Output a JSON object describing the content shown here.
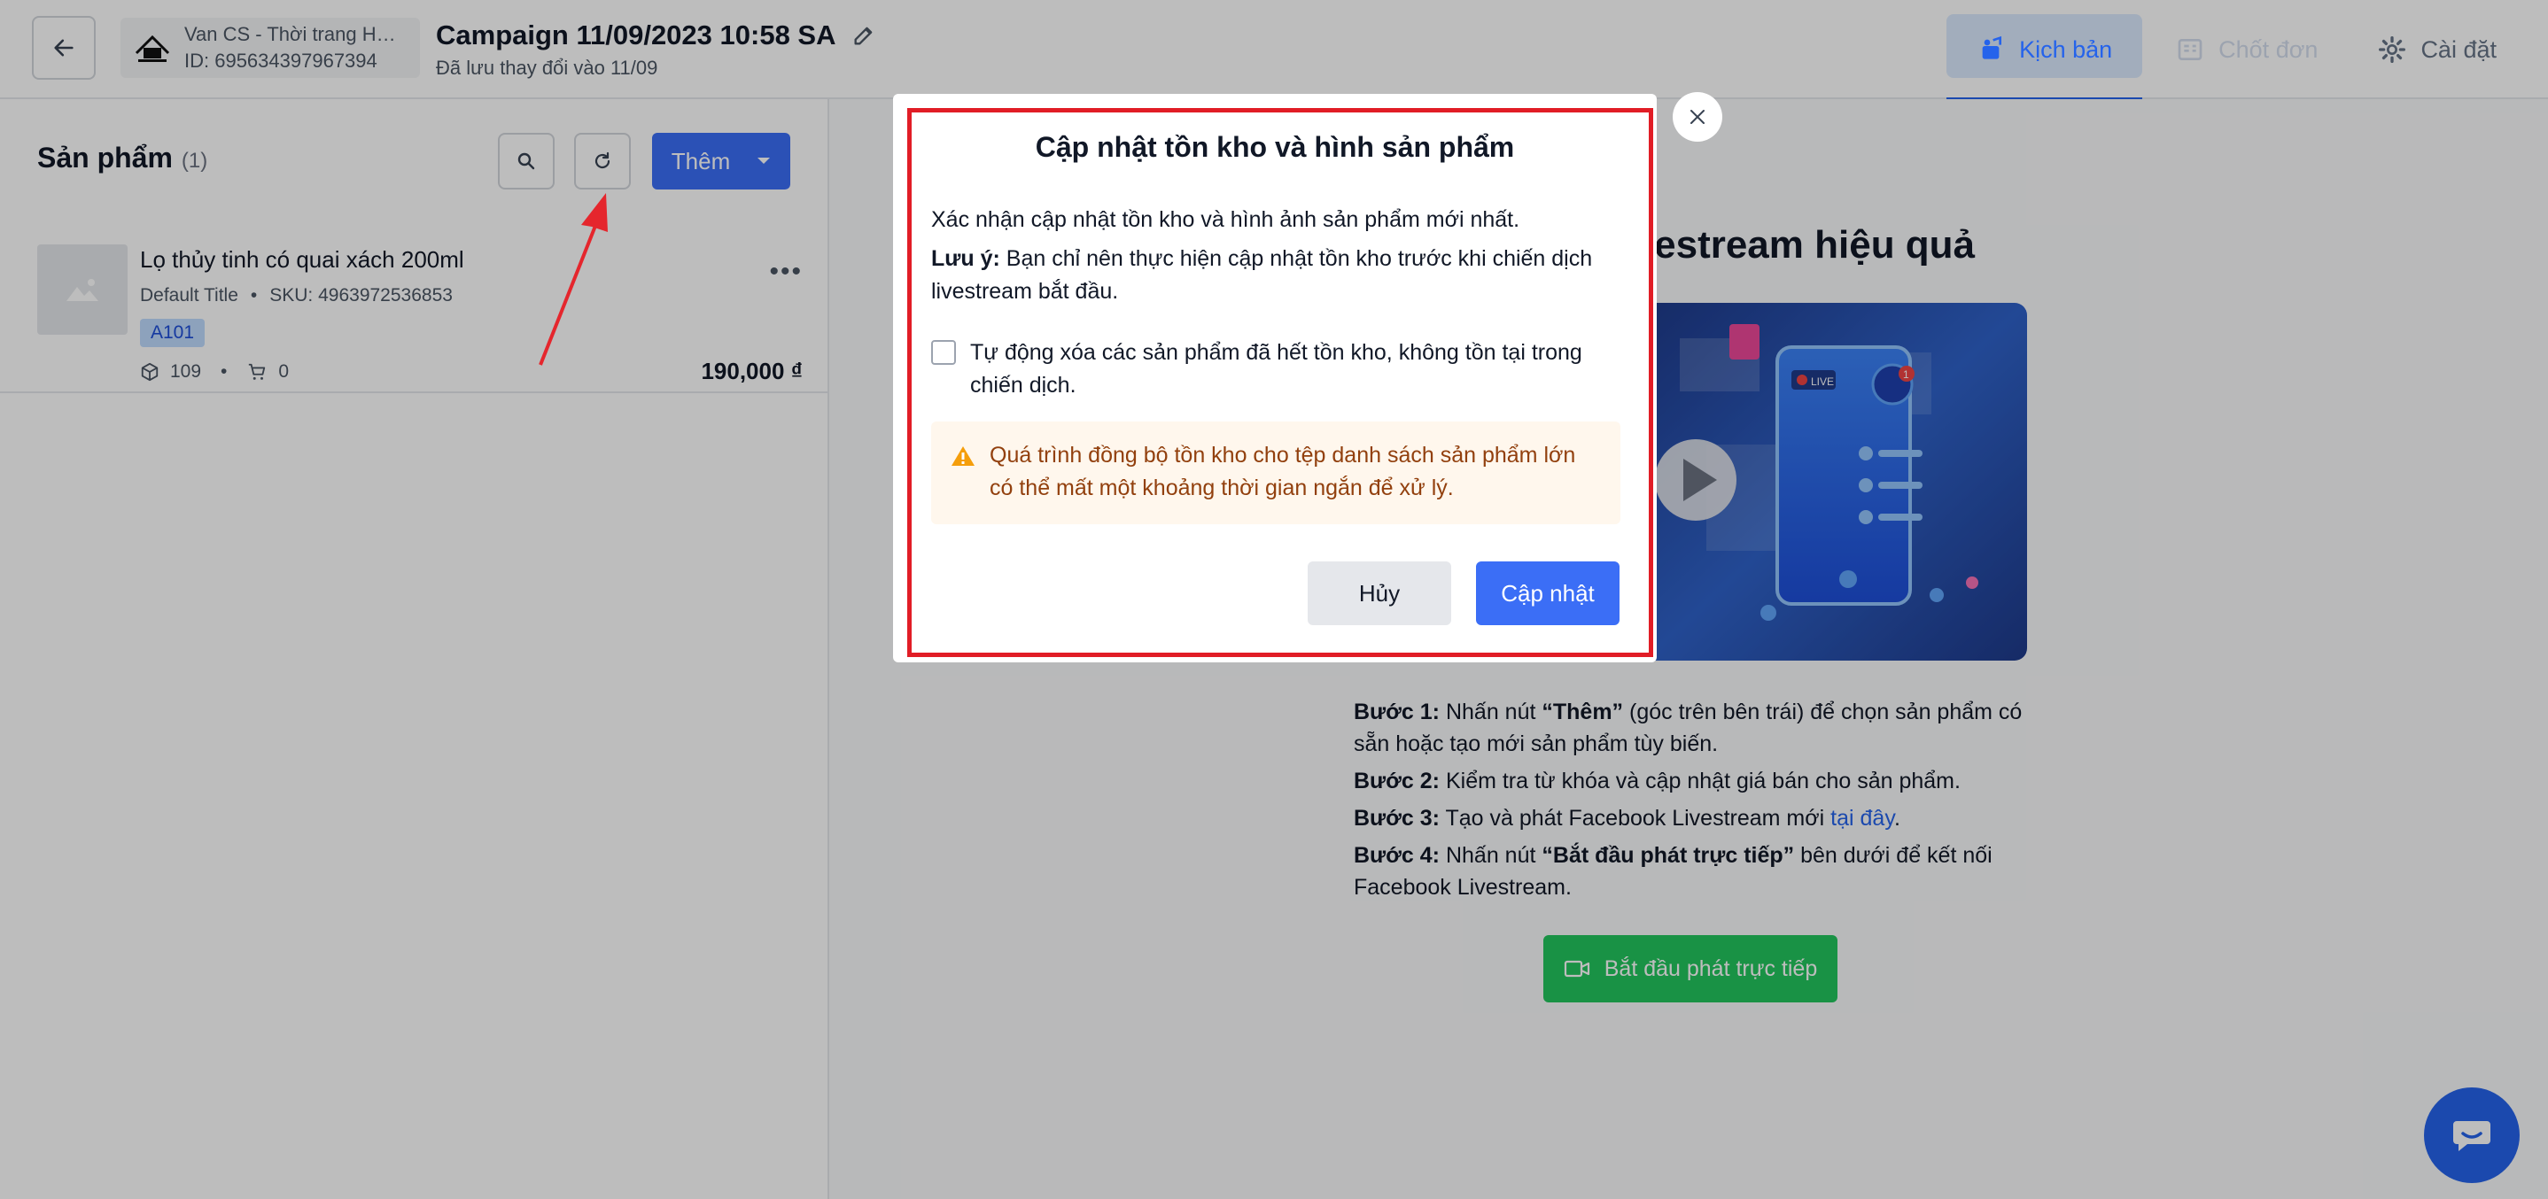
{
  "header": {
    "shop_name": "Van CS - Thời trang Hàn...",
    "shop_id": "ID: 695634397967394",
    "campaign_title": "Campaign 11/09/2023 10:58 SA",
    "campaign_saved": "Đã lưu thay đổi vào 11/09",
    "tabs": [
      {
        "label": "Kịch bản",
        "icon": "script-icon",
        "state": "active"
      },
      {
        "label": "Chốt đơn",
        "icon": "orders-icon",
        "state": "disabled"
      },
      {
        "label": "Cài đặt",
        "icon": "gear-icon",
        "state": "normal"
      }
    ]
  },
  "products_panel": {
    "title": "Sản phẩm",
    "count": "(1)",
    "add_label": "Thêm",
    "items": [
      {
        "name": "Lọ thủy tinh có quai xách 200ml",
        "variant": "Default Title",
        "sku": "SKU: 4963972536853",
        "tag": "A101",
        "stock": "109",
        "cart": "0",
        "price": "190,000 ₫"
      }
    ]
  },
  "guide": {
    "title_partial": "restream hiệu quả",
    "steps": [
      {
        "label": "Bước 1:",
        "pre": " Nhấn nút ",
        "bold": "“Thêm”",
        "post": " (góc trên bên trái) để chọn sản phẩm có sẵn hoặc tạo mới sản phẩm tùy biến."
      },
      {
        "label": "Bước 2:",
        "pre": " Kiểm tra từ khóa và cập nhật giá bán cho sản phẩm."
      },
      {
        "label": "Bước 3:",
        "pre": " Tạo và phát Facebook Livestream mới ",
        "link": "tại đây",
        "post": "."
      },
      {
        "label": "Bước 4:",
        "pre": " Nhấn nút ",
        "bold": "“Bắt đầu phát trực tiếp”",
        "post": " bên dưới để kết nối Facebook Livestream."
      }
    ],
    "live_button": "Bắt đầu phát trực tiếp",
    "live_badge": "LIVE",
    "cart_badge": "1"
  },
  "modal": {
    "title": "Cập nhật tồn kho và hình sản phẩm",
    "line1": "Xác nhận cập nhật tồn kho và hình ảnh sản phẩm mới nhất.",
    "note_label": "Lưu ý:",
    "note_text": " Bạn chỉ nên thực hiện cập nhật tồn kho trước khi chiến dịch livestream bắt đầu.",
    "checkbox_label": "Tự động xóa các sản phẩm đã hết tồn kho, không tồn tại trong chiến dịch.",
    "checkbox_checked": false,
    "warning": "Quá trình đồng bộ tồn kho cho tệp danh sách sản phẩm lớn có thể mất một khoảng thời gian ngắn để xử lý.",
    "cancel_label": "Hủy",
    "update_label": "Cập nhật"
  },
  "colors": {
    "primary": "#3b6ef6",
    "highlight_frame": "#e11d26",
    "annotation_arrow": "#e5262d",
    "warning_bg": "#fff7ed",
    "live_button": "#22c55e"
  }
}
